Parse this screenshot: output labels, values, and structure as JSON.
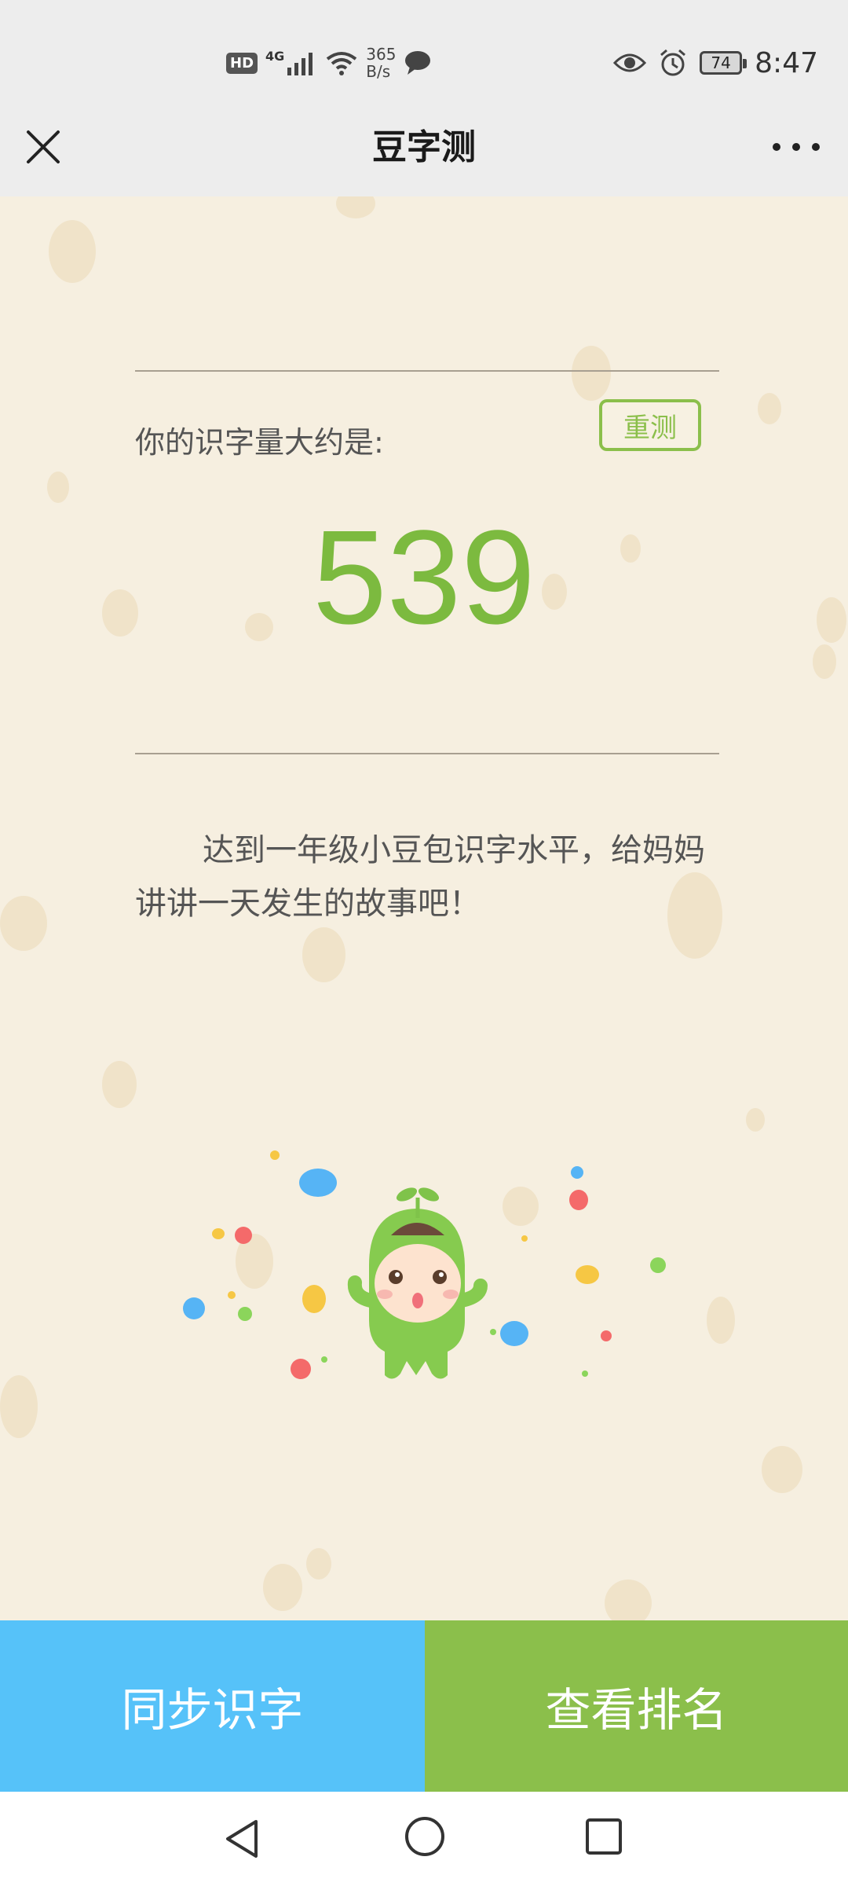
{
  "status_bar": {
    "left_icons": [
      "hd-icon",
      "signal-4g-icon",
      "wifi-icon",
      "chat-bubble-icon"
    ],
    "hd_label": "HD",
    "network_label": "4G",
    "speed_value": "365",
    "speed_unit": "B/s",
    "right_icons": [
      "eye-icon",
      "alarm-icon",
      "battery-icon"
    ],
    "battery_level": "74",
    "time": "8:47"
  },
  "header": {
    "title": "豆字测",
    "close_icon": "close-icon",
    "more_icon": "more-icon"
  },
  "result": {
    "label": "你的识字量大约是:",
    "retest_label": "重测",
    "score": "539",
    "description": "达到一年级小豆包识字水平，给妈妈讲讲一天发生的故事吧！"
  },
  "actions": {
    "sync_label": "同步识字",
    "rank_label": "查看排名",
    "sync_color": "#56c2f9",
    "rank_color": "#8bbf4b"
  },
  "nav": {
    "icons": [
      "back-triangle-icon",
      "home-circle-icon",
      "recent-square-icon"
    ]
  },
  "colors": {
    "accent_green": "#7cba3f",
    "background": "#f6efe0"
  }
}
